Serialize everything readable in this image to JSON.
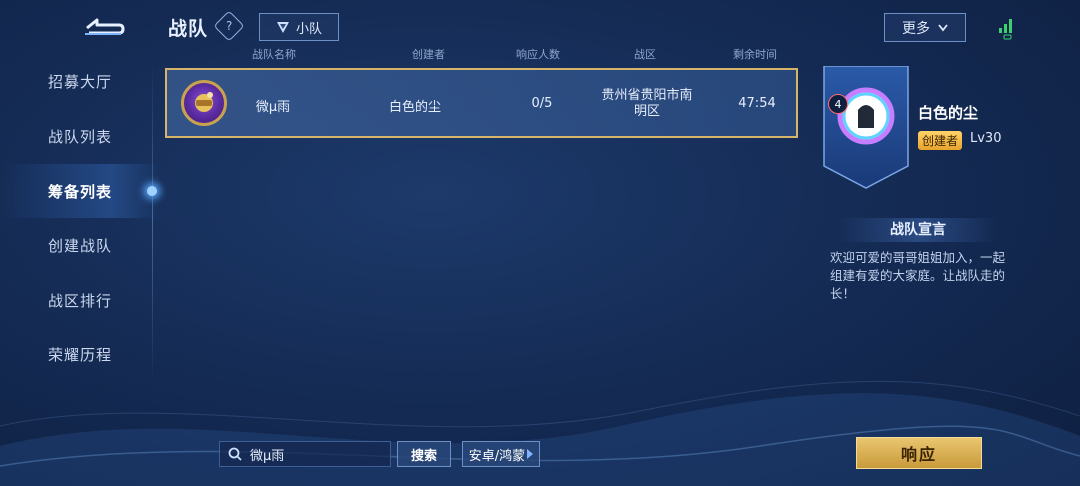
{
  "header": {
    "title": "战队",
    "help_icon": "?",
    "squad_label": "小队",
    "more_label": "更多"
  },
  "sidebar": {
    "items": [
      {
        "label": "招募大厅"
      },
      {
        "label": "战队列表"
      },
      {
        "label": "筹备列表",
        "active": true
      },
      {
        "label": "创建战队"
      },
      {
        "label": "战区排行"
      },
      {
        "label": "荣耀历程"
      }
    ]
  },
  "table": {
    "columns": {
      "name": "战队名称",
      "creator": "创建者",
      "response_count": "响应人数",
      "region": "战区",
      "time_left": "剩余时间"
    },
    "rows": [
      {
        "name": "微μ雨",
        "creator": "白色的尘",
        "response_count": "0/5",
        "region": "贵州省贵阳市南明区",
        "time_left": "47:54"
      }
    ]
  },
  "detail": {
    "rank_number": "4",
    "leader_name": "白色的尘",
    "creator_badge": "创建者",
    "level": "Lv30",
    "declaration_title": "战队宣言",
    "declaration_text": "欢迎可爱的哥哥姐姐加入，一起组建有爱的大家庭。让战队走的长！"
  },
  "bottom": {
    "search_value": "微μ雨",
    "search_button": "搜索",
    "platform_button": "安卓/鸿蒙",
    "respond_button": "响应"
  },
  "colors": {
    "accent_gold": "#d6b56a",
    "background": "#152c56",
    "active_glow": "#5aa8ff"
  }
}
